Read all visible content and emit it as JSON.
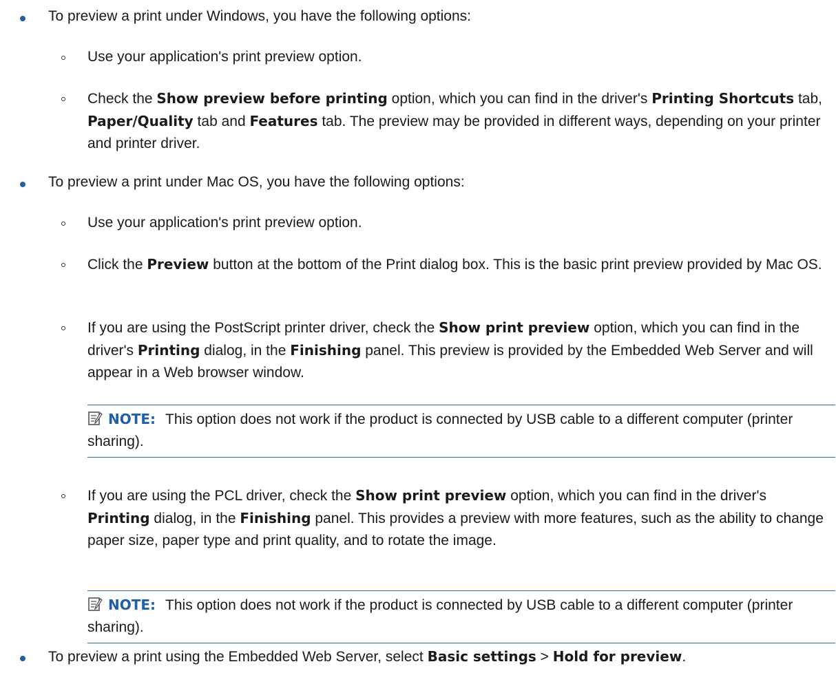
{
  "b1": "To preview a print under Windows, you have the following options:",
  "b1a": "Use your application's print preview option.",
  "b1b": {
    "t1": "Check the ",
    "k1": "Show preview before printing",
    "t2": " option, which you can find in the driver's ",
    "k2": "Printing Shortcuts",
    "t3": " tab, ",
    "k3": "Paper/Quality",
    "t4": " tab and ",
    "k4": "Features",
    "t5": " tab. The preview may be provided in different ways, depending on your printer and printer driver."
  },
  "b2": "To preview a print under Mac OS, you have the following options:",
  "b2a": "Use your application's print preview option.",
  "b2b": {
    "t1": "Click the ",
    "k1": "Preview",
    "t2": " button at the bottom of the Print dialog box. This is the basic print preview provided by Mac OS."
  },
  "b2c": {
    "t1": "If you are using the PostScript printer driver, check the ",
    "k1": "Show print preview",
    "t2": " option, which you can find in the driver's ",
    "k2": "Printing",
    "t3": " dialog, in the ",
    "k3": "Finishing",
    "t4": " panel. This preview is provided by the Embedded Web Server and will appear in a Web browser window."
  },
  "note1": {
    "label": "NOTE:",
    "text": "This option does not work if the product is connected by USB cable to a different computer (printer sharing)."
  },
  "b2d": {
    "t1": "If you are using the PCL driver, check the ",
    "k1": "Show print preview",
    "t2": " option, which you can find in the driver's ",
    "k2": "Printing",
    "t3": " dialog, in the ",
    "k3": "Finishing",
    "t4": " panel. This provides a preview with more features, such as the ability to change paper size, paper type and print quality, and to rotate the image."
  },
  "note2": {
    "label": "NOTE:",
    "text": "This option does not work if the product is connected by USB cable to a different computer (printer sharing)."
  },
  "b3": {
    "t1": "To preview a print using the Embedded Web Server, select ",
    "k1": "Basic settings",
    "t2": " > ",
    "k2": "Hold for preview",
    "t3": "."
  }
}
